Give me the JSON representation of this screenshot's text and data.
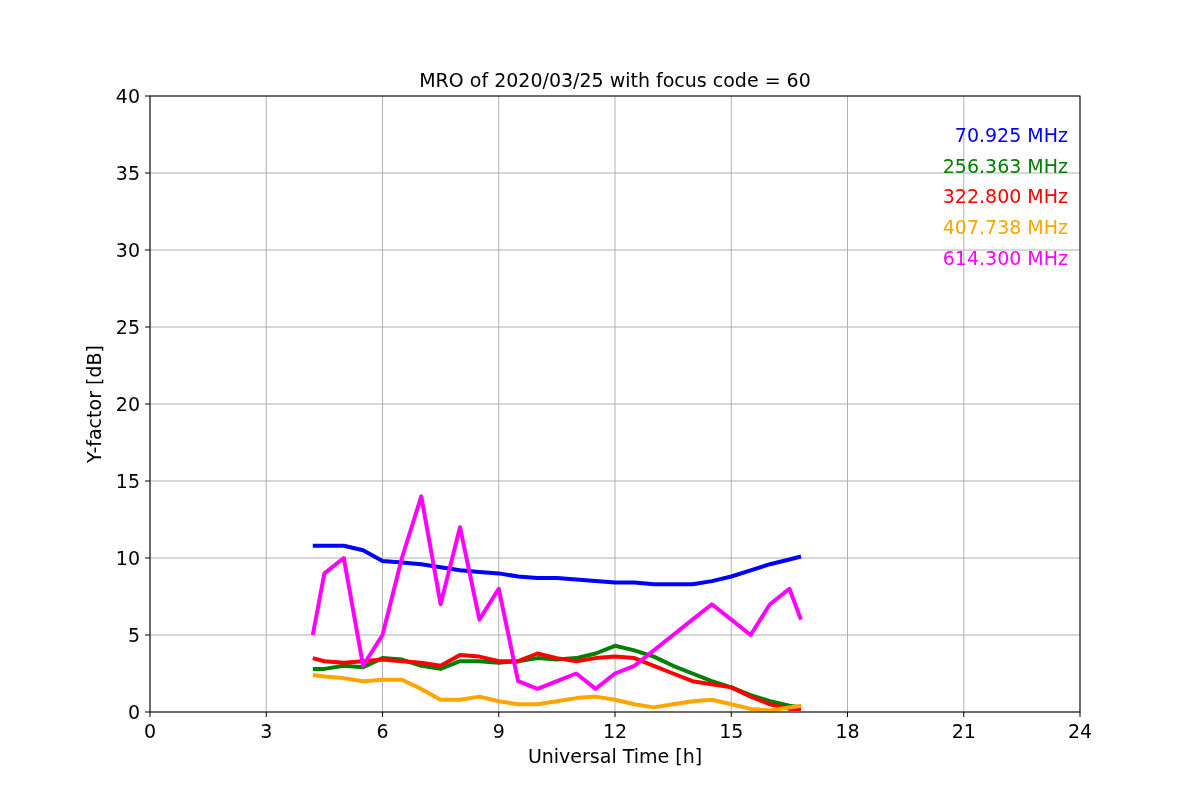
{
  "figure": {
    "chart_data": {
      "type": "line",
      "grid": true,
      "title": "MRO of 2020/03/25 with focus code = 60",
      "xlabel": "Universal Time [h]",
      "ylabel": "Y-factor [dB]",
      "xlim": [
        0,
        24
      ],
      "ylim": [
        0,
        40
      ],
      "xticks": [
        0,
        3,
        6,
        9,
        12,
        15,
        18,
        21,
        24
      ],
      "yticks": [
        0,
        5,
        10,
        15,
        20,
        25,
        30,
        35,
        40
      ],
      "x": [
        4.2,
        4.5,
        5,
        5.5,
        6,
        6.5,
        7,
        7.5,
        8,
        8.5,
        9,
        9.5,
        10,
        10.5,
        11,
        11.5,
        12,
        12.5,
        13,
        13.5,
        14,
        14.5,
        15,
        15.5,
        16,
        16.5,
        16.8
      ],
      "series": [
        {
          "name": "70.925 MHz",
          "color": "#0000ff",
          "values": [
            10.8,
            10.8,
            10.8,
            10.5,
            9.8,
            9.7,
            9.6,
            9.4,
            9.2,
            9.1,
            9.0,
            8.8,
            8.7,
            8.7,
            8.6,
            8.5,
            8.4,
            8.4,
            8.3,
            8.3,
            8.3,
            8.5,
            8.8,
            9.2,
            9.6,
            9.9,
            10.1
          ]
        },
        {
          "name": "256.363 MHz",
          "color": "#008000",
          "values": [
            2.8,
            2.8,
            3.0,
            2.9,
            3.5,
            3.4,
            3.0,
            2.8,
            3.3,
            3.3,
            3.2,
            3.3,
            3.5,
            3.4,
            3.5,
            3.8,
            4.3,
            4.0,
            3.6,
            3.0,
            2.5,
            2.0,
            1.6,
            1.1,
            0.7,
            0.4,
            0.3
          ]
        },
        {
          "name": "322.800 MHz",
          "color": "#ff0000",
          "values": [
            3.5,
            3.3,
            3.2,
            3.3,
            3.4,
            3.3,
            3.2,
            3.0,
            3.7,
            3.6,
            3.3,
            3.3,
            3.8,
            3.5,
            3.3,
            3.5,
            3.6,
            3.5,
            3.0,
            2.5,
            2.0,
            1.8,
            1.6,
            1.0,
            0.5,
            0.2,
            0.2
          ]
        },
        {
          "name": "407.738 MHz",
          "color": "#ffa500",
          "values": [
            2.4,
            2.3,
            2.2,
            2.0,
            2.1,
            2.1,
            1.5,
            0.8,
            0.8,
            1.0,
            0.7,
            0.5,
            0.5,
            0.7,
            0.9,
            1.0,
            0.8,
            0.5,
            0.3,
            0.5,
            0.7,
            0.8,
            0.5,
            0.2,
            0.1,
            0.3,
            0.4
          ]
        },
        {
          "name": "614.300 MHz",
          "color": "#ff00ff",
          "values": [
            5,
            9,
            10,
            3,
            5,
            10,
            14,
            7,
            12,
            6,
            8,
            2,
            1.5,
            2,
            2.5,
            1.5,
            2.5,
            3,
            4,
            5,
            6,
            7,
            6,
            5,
            7,
            8,
            6
          ]
        }
      ]
    }
  }
}
